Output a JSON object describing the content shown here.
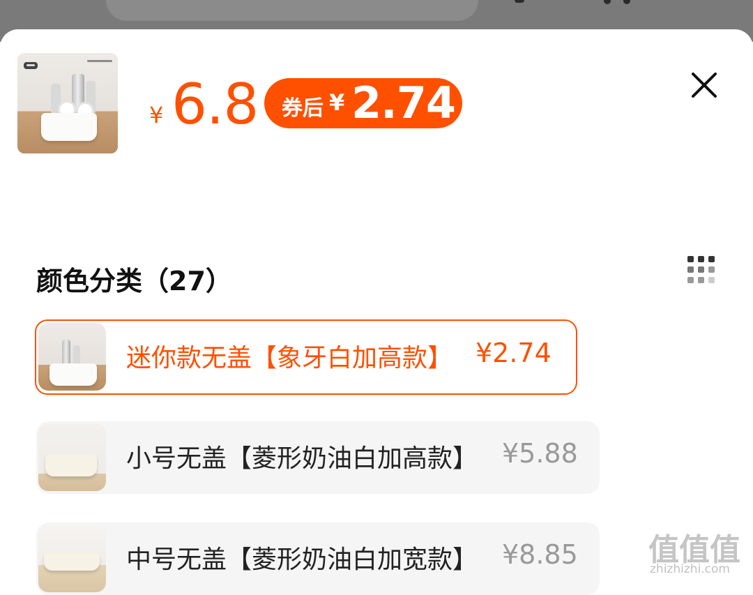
{
  "product": {
    "currency_symbol": "¥",
    "price": "6.8",
    "coupon_label": "券后",
    "coupon_currency": "¥",
    "coupon_price": "2.74"
  },
  "section": {
    "title": "颜色分类（27）"
  },
  "options": [
    {
      "label": "迷你款无盖【象牙白加高款】",
      "price": "¥2.74",
      "selected": true
    },
    {
      "label": "小号无盖【菱形奶油白加高款】",
      "price": "¥5.88",
      "selected": false
    },
    {
      "label": "中号无盖【菱形奶油白加宽款】",
      "price": "¥8.85",
      "selected": false
    }
  ],
  "icons": {
    "close": "close-icon",
    "grid": "grid-view-icon"
  },
  "colors": {
    "accent": "#ff5000",
    "muted_price": "#999999",
    "title": "#111111",
    "option_bg": "#f5f5f5"
  },
  "watermark": {
    "glyphs": "值值值",
    "domain": "zhizhizhi.com"
  }
}
